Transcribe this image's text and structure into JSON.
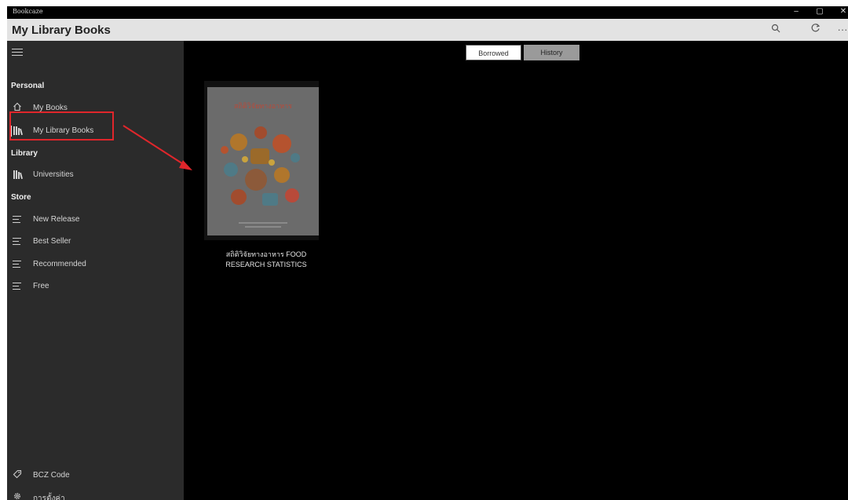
{
  "window": {
    "title": "Bookcaze",
    "controls": [
      "–",
      "▢",
      "✕"
    ]
  },
  "header": {
    "title": "My Library Books",
    "search_icon": "search-icon",
    "refresh_icon": "refresh-icon",
    "more_label": "···"
  },
  "sidebar": {
    "sections": [
      {
        "heading": "Personal",
        "items": [
          {
            "label": "My Books",
            "icon": "home-icon"
          },
          {
            "label": "My Library Books",
            "icon": "books-icon",
            "active": true
          }
        ]
      },
      {
        "heading": "Library",
        "items": [
          {
            "label": "Universities",
            "icon": "books-icon"
          }
        ]
      },
      {
        "heading": "Store",
        "items": [
          {
            "label": "New Release",
            "icon": "list-icon"
          },
          {
            "label": "Best Seller",
            "icon": "list-icon"
          },
          {
            "label": "Recommended",
            "icon": "list-icon"
          },
          {
            "label": "Free",
            "icon": "list-icon"
          }
        ]
      }
    ],
    "footer": [
      {
        "label": "BCZ Code",
        "icon": "tag-icon"
      },
      {
        "label": "การตั้งค่า",
        "icon": "gear-icon"
      }
    ]
  },
  "main": {
    "tabs": [
      {
        "label": "Borrowed",
        "selected": true
      },
      {
        "label": "History",
        "selected": false
      }
    ],
    "books": [
      {
        "cover_title": "สถิติวิจัยทางอาหาร",
        "title_line1": "สถิติวิจัยทางอาหาร FOOD",
        "title_line2": "RESEARCH STATISTICS"
      }
    ]
  },
  "colors": {
    "annotation": "#e0262b",
    "sidebar_bg": "#2b2b2b",
    "header_bg": "#e3e3e3"
  }
}
